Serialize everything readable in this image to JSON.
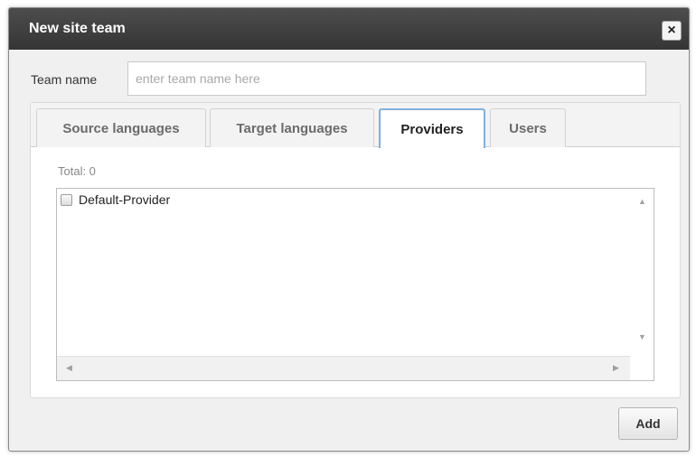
{
  "dialog": {
    "title": "New site team",
    "close_symbol": "×"
  },
  "team": {
    "label": "Team name",
    "value": "",
    "placeholder": "enter team name here"
  },
  "tabs": [
    {
      "label": "Source languages",
      "active": false
    },
    {
      "label": "Target languages",
      "active": false
    },
    {
      "label": "Providers",
      "active": true
    },
    {
      "label": "Users",
      "active": false
    }
  ],
  "providers": {
    "total_text": "Total: 0",
    "items": [
      {
        "label": "Default-Provider",
        "checked": false
      }
    ]
  },
  "footer": {
    "add_label": "Add"
  },
  "icons": {
    "close": "close-icon",
    "scroll_up": "scroll-up-arrow-icon",
    "scroll_down": "scroll-down-arrow-icon",
    "scroll_left": "scroll-left-arrow-icon",
    "scroll_right": "scroll-right-arrow-icon"
  },
  "colors": {
    "titlebar": "#3f3f3f",
    "active_tab_border": "#7fb0e0"
  }
}
